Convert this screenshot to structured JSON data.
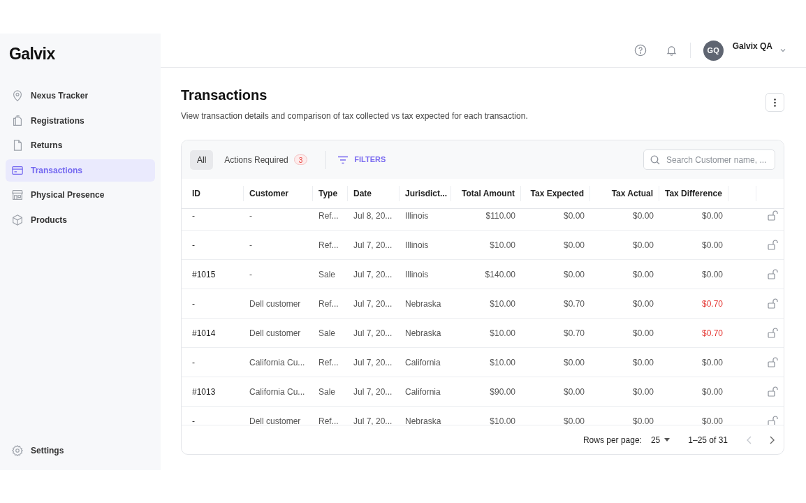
{
  "logo": "Galvix",
  "sidebar": {
    "items": [
      {
        "label": "Nexus Tracker",
        "selected": false
      },
      {
        "label": "Registrations",
        "selected": false
      },
      {
        "label": "Returns",
        "selected": false
      },
      {
        "label": "Transactions",
        "selected": true
      },
      {
        "label": "Physical Presence",
        "selected": false
      },
      {
        "label": "Products",
        "selected": false
      }
    ],
    "footer": {
      "label": "Settings",
      "selected": false
    }
  },
  "header": {
    "user": {
      "initials": "GQ",
      "name": "Galvix QA"
    }
  },
  "page": {
    "title": "Transactions",
    "description": "View transaction details and comparison of tax collected vs tax expected for each transaction."
  },
  "toolbar": {
    "tabs": [
      {
        "label": "All",
        "selected": true
      },
      {
        "label": "Actions Required",
        "badge": "3",
        "selected": false
      }
    ],
    "filters": "FILTERS",
    "search": {
      "placeholder": "Search Customer name, ..."
    }
  },
  "table": {
    "columns": [
      "ID",
      "Customer",
      "Type",
      "Date",
      "Jurisdict...",
      "Total Amount",
      "Tax Expected",
      "Tax Actual",
      "Tax Difference"
    ],
    "rows": [
      {
        "id": "-",
        "customer": "-",
        "type": "Ref...",
        "date": "Jul 8, 20...",
        "jurisdiction": "Illinois",
        "total": "$110.00",
        "tax_expected": "$0.00",
        "tax_actual": "$0.00",
        "tax_difference": "$0.00",
        "mismatch": false
      },
      {
        "id": "-",
        "customer": "-",
        "type": "Ref...",
        "date": "Jul 7, 20...",
        "jurisdiction": "Illinois",
        "total": "$10.00",
        "tax_expected": "$0.00",
        "tax_actual": "$0.00",
        "tax_difference": "$0.00",
        "mismatch": false
      },
      {
        "id": "#1015",
        "customer": "-",
        "type": "Sale",
        "date": "Jul 7, 20...",
        "jurisdiction": "Illinois",
        "total": "$140.00",
        "tax_expected": "$0.00",
        "tax_actual": "$0.00",
        "tax_difference": "$0.00",
        "mismatch": false
      },
      {
        "id": "-",
        "customer": "Dell customer",
        "type": "Ref...",
        "date": "Jul 7, 20...",
        "jurisdiction": "Nebraska",
        "total": "$10.00",
        "tax_expected": "$0.70",
        "tax_actual": "$0.00",
        "tax_difference": "$0.70",
        "mismatch": true
      },
      {
        "id": "#1014",
        "customer": "Dell customer",
        "type": "Sale",
        "date": "Jul 7, 20...",
        "jurisdiction": "Nebraska",
        "total": "$10.00",
        "tax_expected": "$0.70",
        "tax_actual": "$0.00",
        "tax_difference": "$0.70",
        "mismatch": true
      },
      {
        "id": "-",
        "customer": "California Cu...",
        "type": "Ref...",
        "date": "Jul 7, 20...",
        "jurisdiction": "California",
        "total": "$10.00",
        "tax_expected": "$0.00",
        "tax_actual": "$0.00",
        "tax_difference": "$0.00",
        "mismatch": false
      },
      {
        "id": "#1013",
        "customer": "California Cu...",
        "type": "Sale",
        "date": "Jul 7, 20...",
        "jurisdiction": "California",
        "total": "$90.00",
        "tax_expected": "$0.00",
        "tax_actual": "$0.00",
        "tax_difference": "$0.00",
        "mismatch": false
      },
      {
        "id": "-",
        "customer": "Dell customer",
        "type": "Ref...",
        "date": "Jul 7, 20...",
        "jurisdiction": "Nebraska",
        "total": "$10.00",
        "tax_expected": "$0.00",
        "tax_actual": "$0.00",
        "tax_difference": "$0.00",
        "mismatch": false
      }
    ]
  },
  "pagination": {
    "rows_per_page_label": "Rows per page:",
    "rows_per_page": "25",
    "range": "1–25 of 31"
  }
}
